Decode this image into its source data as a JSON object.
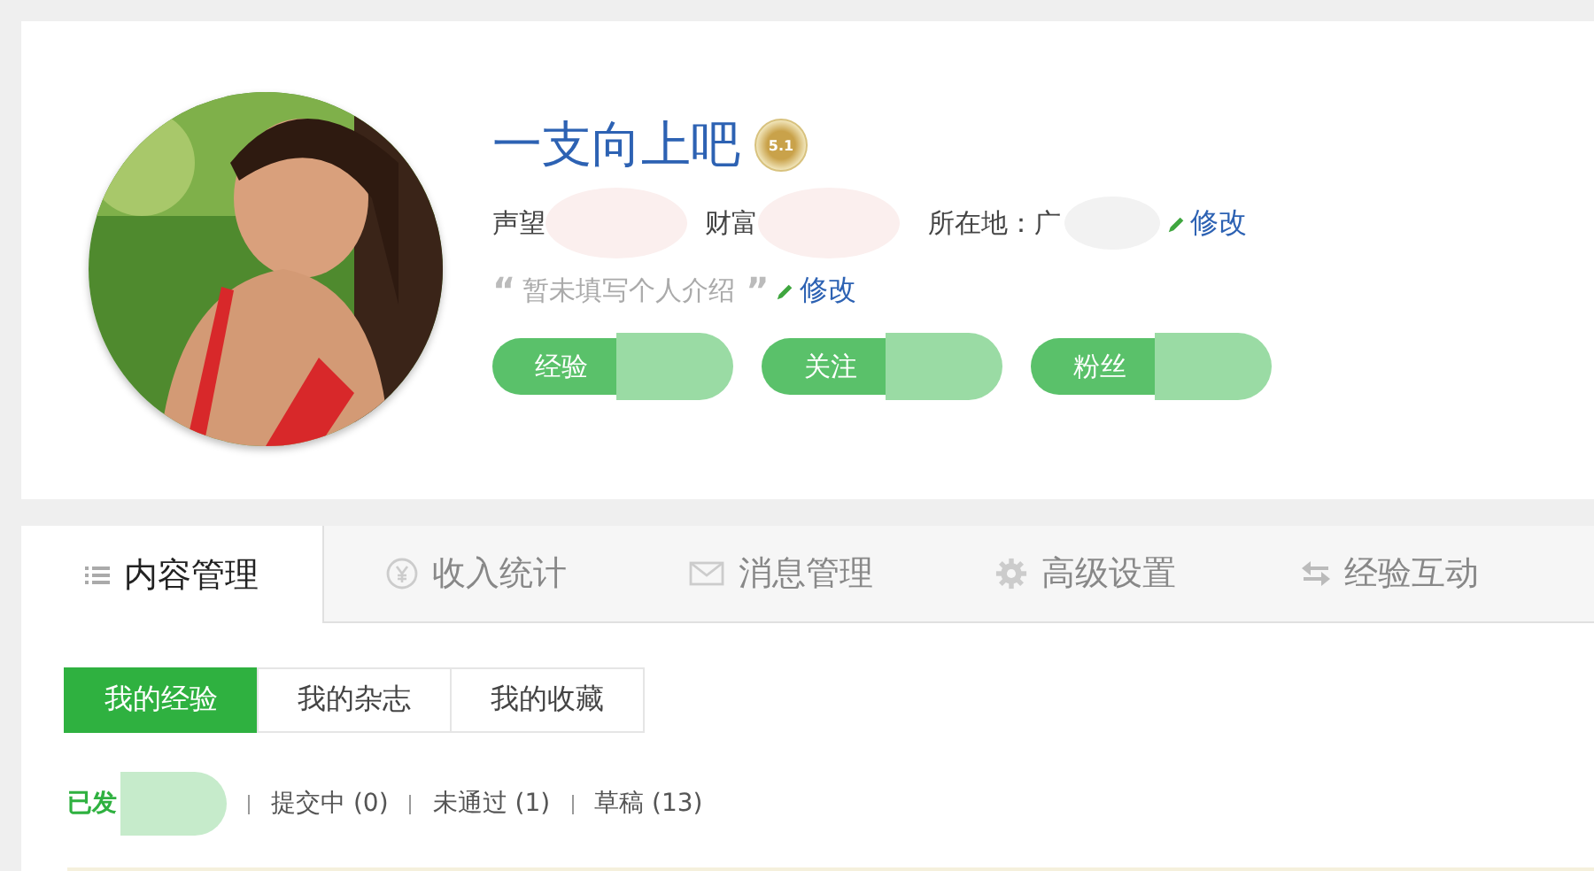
{
  "profile": {
    "name": "一支向上吧",
    "badge": "5.1",
    "stats": [
      {
        "label": "声望"
      },
      {
        "label": "财富"
      }
    ],
    "location_label": "所在地：",
    "location": "广",
    "edit_link": "修改",
    "intro_open": "“",
    "intro": "暂未填写个人介绍",
    "intro_close": "”",
    "intro_edit_link": "修改",
    "counters": [
      {
        "label": "经验"
      },
      {
        "label": "关注"
      },
      {
        "label": "粉丝"
      }
    ]
  },
  "tabs": [
    {
      "label": "内容管理",
      "selected": true
    },
    {
      "label": "收入统计",
      "selected": false
    },
    {
      "label": "消息管理",
      "selected": false
    },
    {
      "label": "高级设置",
      "selected": false
    },
    {
      "label": "经验互动",
      "selected": false
    }
  ],
  "subtabs": [
    {
      "label": "我的经验",
      "selected": true
    },
    {
      "label": "我的杂志",
      "selected": false
    },
    {
      "label": "我的收藏",
      "selected": false
    }
  ],
  "filters": [
    {
      "label": "已发",
      "selected": true
    },
    {
      "label": "提交中 (0)",
      "selected": false
    },
    {
      "label": "未通过 (1)",
      "selected": false
    },
    {
      "label": "草稿 (13)",
      "selected": false
    }
  ]
}
